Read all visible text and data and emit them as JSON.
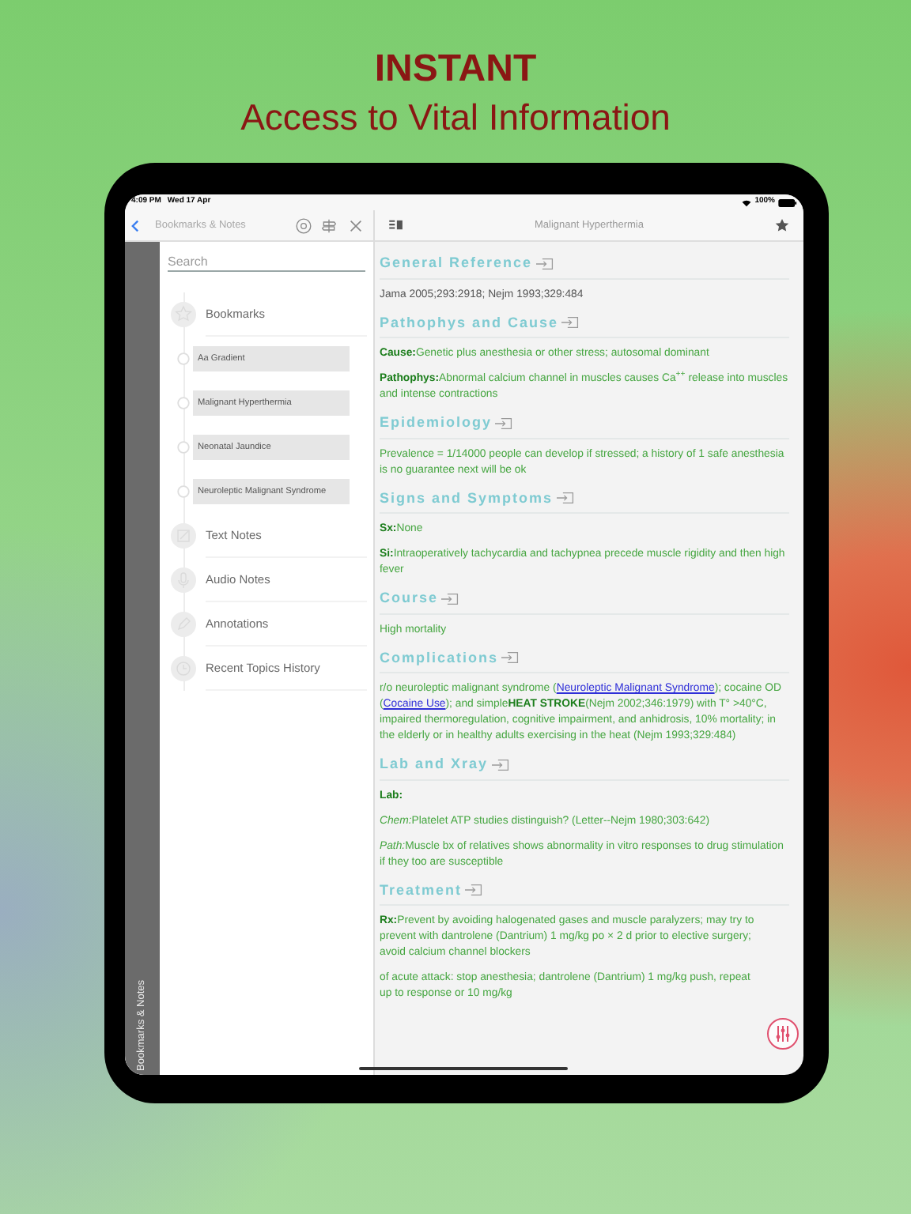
{
  "headline": {
    "title": "INSTANT",
    "subtitle": "Access to Vital Information"
  },
  "status_bar": {
    "time": "4:09 PM",
    "date": "Wed 17 Apr",
    "battery": "100%"
  },
  "sidebar": {
    "title": "Bookmarks & Notes",
    "search": {
      "placeholder": "Search"
    },
    "side_tab": "Bookmarks & Notes",
    "sections": [
      {
        "label": "Bookmarks",
        "children": [
          {
            "label": "Aa Gradient"
          },
          {
            "label": "Malignant Hyperthermia"
          },
          {
            "label": "Neonatal Jaundice"
          },
          {
            "label": "Neuroleptic Malignant Syndrome"
          }
        ]
      },
      {
        "label": "Text Notes"
      },
      {
        "label": "Audio Notes"
      },
      {
        "label": "Annotations"
      },
      {
        "label": "Recent Topics History"
      }
    ]
  },
  "content": {
    "title": "Malignant Hyperthermia",
    "sections": [
      {
        "heading": "General Reference",
        "paragraphs": [
          {
            "kind": "plain",
            "parts": [
              {
                "kind": "text",
                "text": "Jama 2005;293:2918; Nejm 1993;329:484"
              }
            ]
          }
        ]
      },
      {
        "heading": "Pathophys and Cause",
        "paragraphs": [
          {
            "kind": "finding",
            "parts": [
              {
                "kind": "text",
                "text": "**Cause:**Genetic plus anesthesia or other stress; autosomal dominant"
              }
            ]
          },
          {
            "kind": "finding",
            "parts": [
              {
                "kind": "text",
                "text": "**Pathophys:**Abnormal calcium channel in muscles causes Ca$^{++}$ release into muscles and intense contractions"
              }
            ]
          }
        ]
      },
      {
        "heading": "Epidemiology",
        "paragraphs": [
          {
            "kind": "finding",
            "parts": [
              {
                "kind": "text",
                "text": "Prevalence = 1/14000 people can develop if stressed; a history of 1 safe anesthesia is no guarantee next will be ok"
              }
            ]
          }
        ]
      },
      {
        "heading": "Signs and Symptoms",
        "paragraphs": [
          {
            "kind": "finding",
            "parts": [
              {
                "kind": "text",
                "text": "**Sx:**None"
              }
            ]
          },
          {
            "kind": "finding",
            "parts": [
              {
                "kind": "text",
                "text": "**Si:**Intraoperatively tachycardia and tachypnea precede muscle rigidity and then high fever"
              }
            ]
          }
        ]
      },
      {
        "heading": "Course",
        "paragraphs": [
          {
            "kind": "finding",
            "parts": [
              {
                "kind": "text",
                "text": "High mortality"
              }
            ]
          }
        ]
      },
      {
        "heading": "Complications",
        "paragraphs": [
          {
            "kind": "finding",
            "parts": [
              {
                "kind": "text",
                "text": "r/o neuroleptic malignant syndrome ("
              },
              {
                "kind": "link",
                "text": "Neuroleptic Malignant Syndrome"
              },
              {
                "kind": "text",
                "text": "); cocaine OD ("
              },
              {
                "kind": "link",
                "text": "Cocaine Use"
              },
              {
                "kind": "text",
                "text": "); and simple**HEAT STROKE**(Nejm 2002;346:1979) with T° >40°C, impaired thermoregulation, cognitive impairment, and anhidrosis, 10% mortality; in the elderly or in healthy adults exercising in the heat (Nejm 1993;329:484)"
              }
            ]
          }
        ]
      },
      {
        "heading": "Lab and Xray",
        "paragraphs": [
          {
            "kind": "finding",
            "parts": [
              {
                "kind": "text",
                "text": "**Lab:**"
              }
            ]
          },
          {
            "kind": "finding",
            "parts": [
              {
                "kind": "label",
                "text": "Chem:"
              },
              {
                "kind": "text",
                "text": "Platelet ATP studies distinguish? (Letter--Nejm 1980;303:642)"
              }
            ]
          },
          {
            "kind": "finding",
            "parts": [
              {
                "kind": "label",
                "text": "Path:"
              },
              {
                "kind": "text",
                "text": "Muscle bx of relatives shows abnormality in vitro responses to drug stimulation if they too are susceptible"
              }
            ]
          }
        ]
      },
      {
        "heading": "Treatment",
        "paragraphs": [
          {
            "kind": "finding",
            "parts": [
              {
                "kind": "text",
                "text": "**Rx:**Prevent by avoiding halogenated gases and muscle paralyzers; may try to prevent with dantrolene (Dantrium) 1 mg/kg po × 2 d prior to elective surgery; avoid calcium channel blockers"
              }
            ]
          },
          {
            "kind": "finding",
            "parts": [
              {
                "kind": "text",
                "text": "of acute attack: stop anesthesia; dantrolene (Dantrium) 1 mg/kg push, repeat up to response or 10 mg/kg"
              }
            ]
          }
        ]
      }
    ]
  }
}
